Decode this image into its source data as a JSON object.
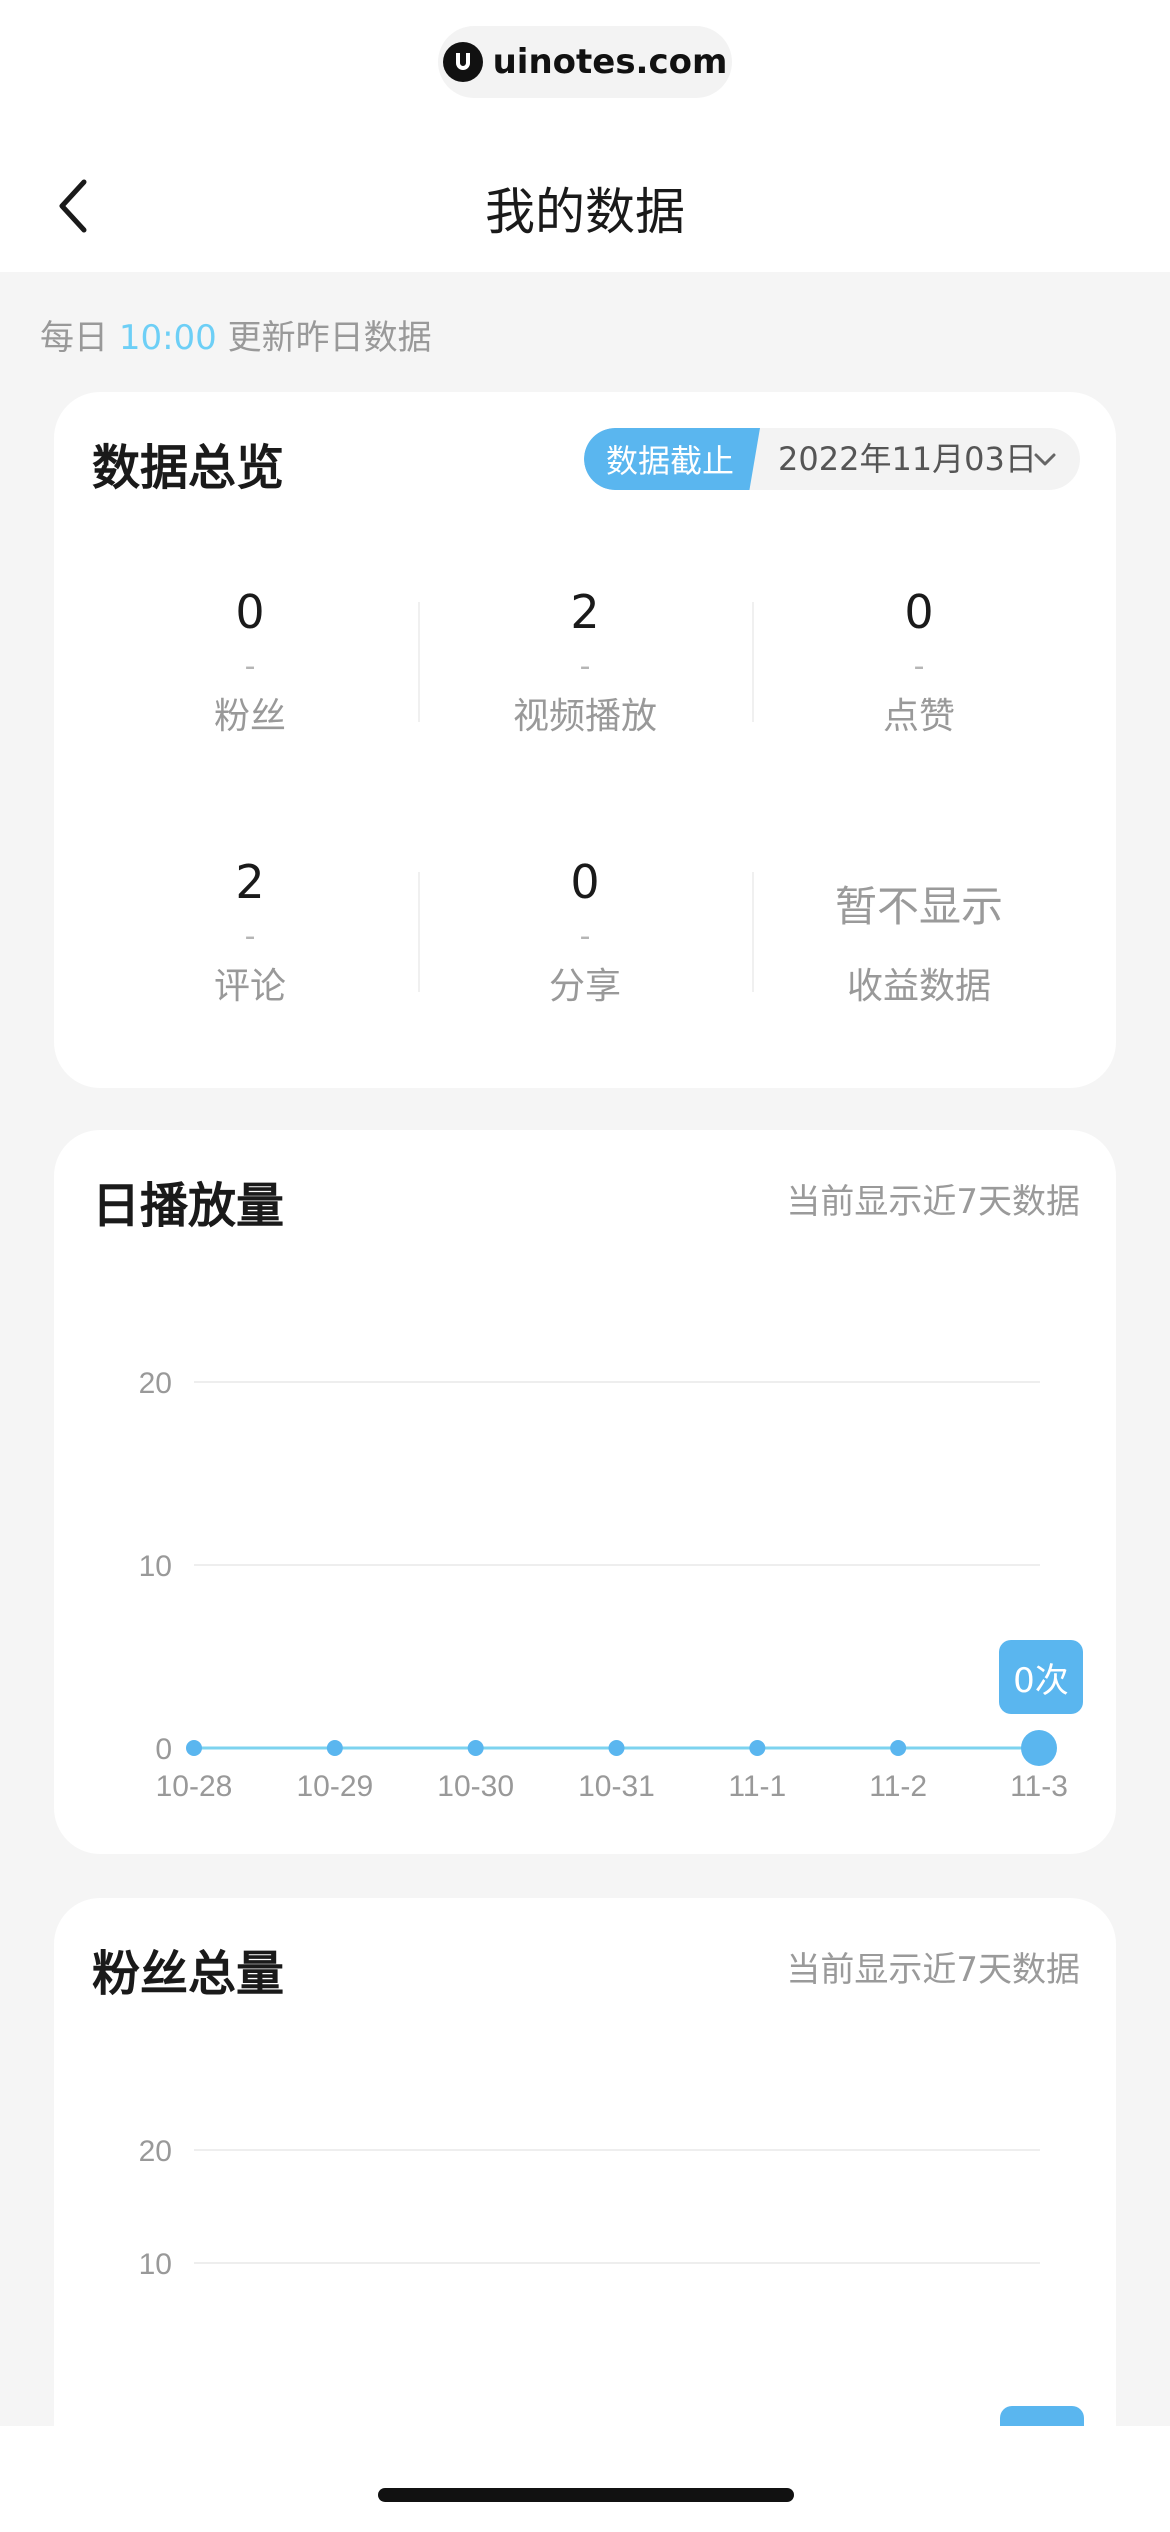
{
  "watermark": {
    "text": "uinotes.com"
  },
  "header": {
    "title": "我的数据",
    "back_icon": "chevron-left-icon"
  },
  "update_note": {
    "prefix": "每日",
    "time": "10:00",
    "suffix": "更新昨日数据"
  },
  "overview": {
    "title": "数据总览",
    "cutoff_label": "数据截止",
    "date": "2022年11月03日",
    "stats": [
      {
        "value": "0",
        "change": "-",
        "label": "粉丝"
      },
      {
        "value": "2",
        "change": "-",
        "label": "视频播放"
      },
      {
        "value": "0",
        "change": "-",
        "label": "点赞"
      },
      {
        "value": "2",
        "change": "-",
        "label": "评论"
      },
      {
        "value": "0",
        "change": "-",
        "label": "分享"
      },
      {
        "value": "暂不显示",
        "change": "",
        "label": "收益数据"
      }
    ]
  },
  "daily_plays": {
    "title": "日播放量",
    "note": "当前显示近7天数据",
    "tooltip": "0次"
  },
  "follower_total": {
    "title": "粉丝总量",
    "note": "当前显示近7天数据"
  },
  "chart_data": [
    {
      "type": "line",
      "title": "日播放量",
      "x": [
        "10-28",
        "10-29",
        "10-30",
        "10-31",
        "11-1",
        "11-2",
        "11-3"
      ],
      "y_ticks": [
        "0",
        "10",
        "20"
      ],
      "ylim": [
        0,
        20
      ],
      "series": [
        {
          "values": [
            0,
            0,
            0,
            0,
            0,
            0,
            0
          ]
        }
      ],
      "grid": true,
      "color": "#5ab6ef",
      "highlight": {
        "x": "11-3",
        "label": "0次"
      }
    },
    {
      "type": "line",
      "title": "粉丝总量",
      "y_ticks": [
        "10",
        "20"
      ],
      "grid": true
    }
  ]
}
